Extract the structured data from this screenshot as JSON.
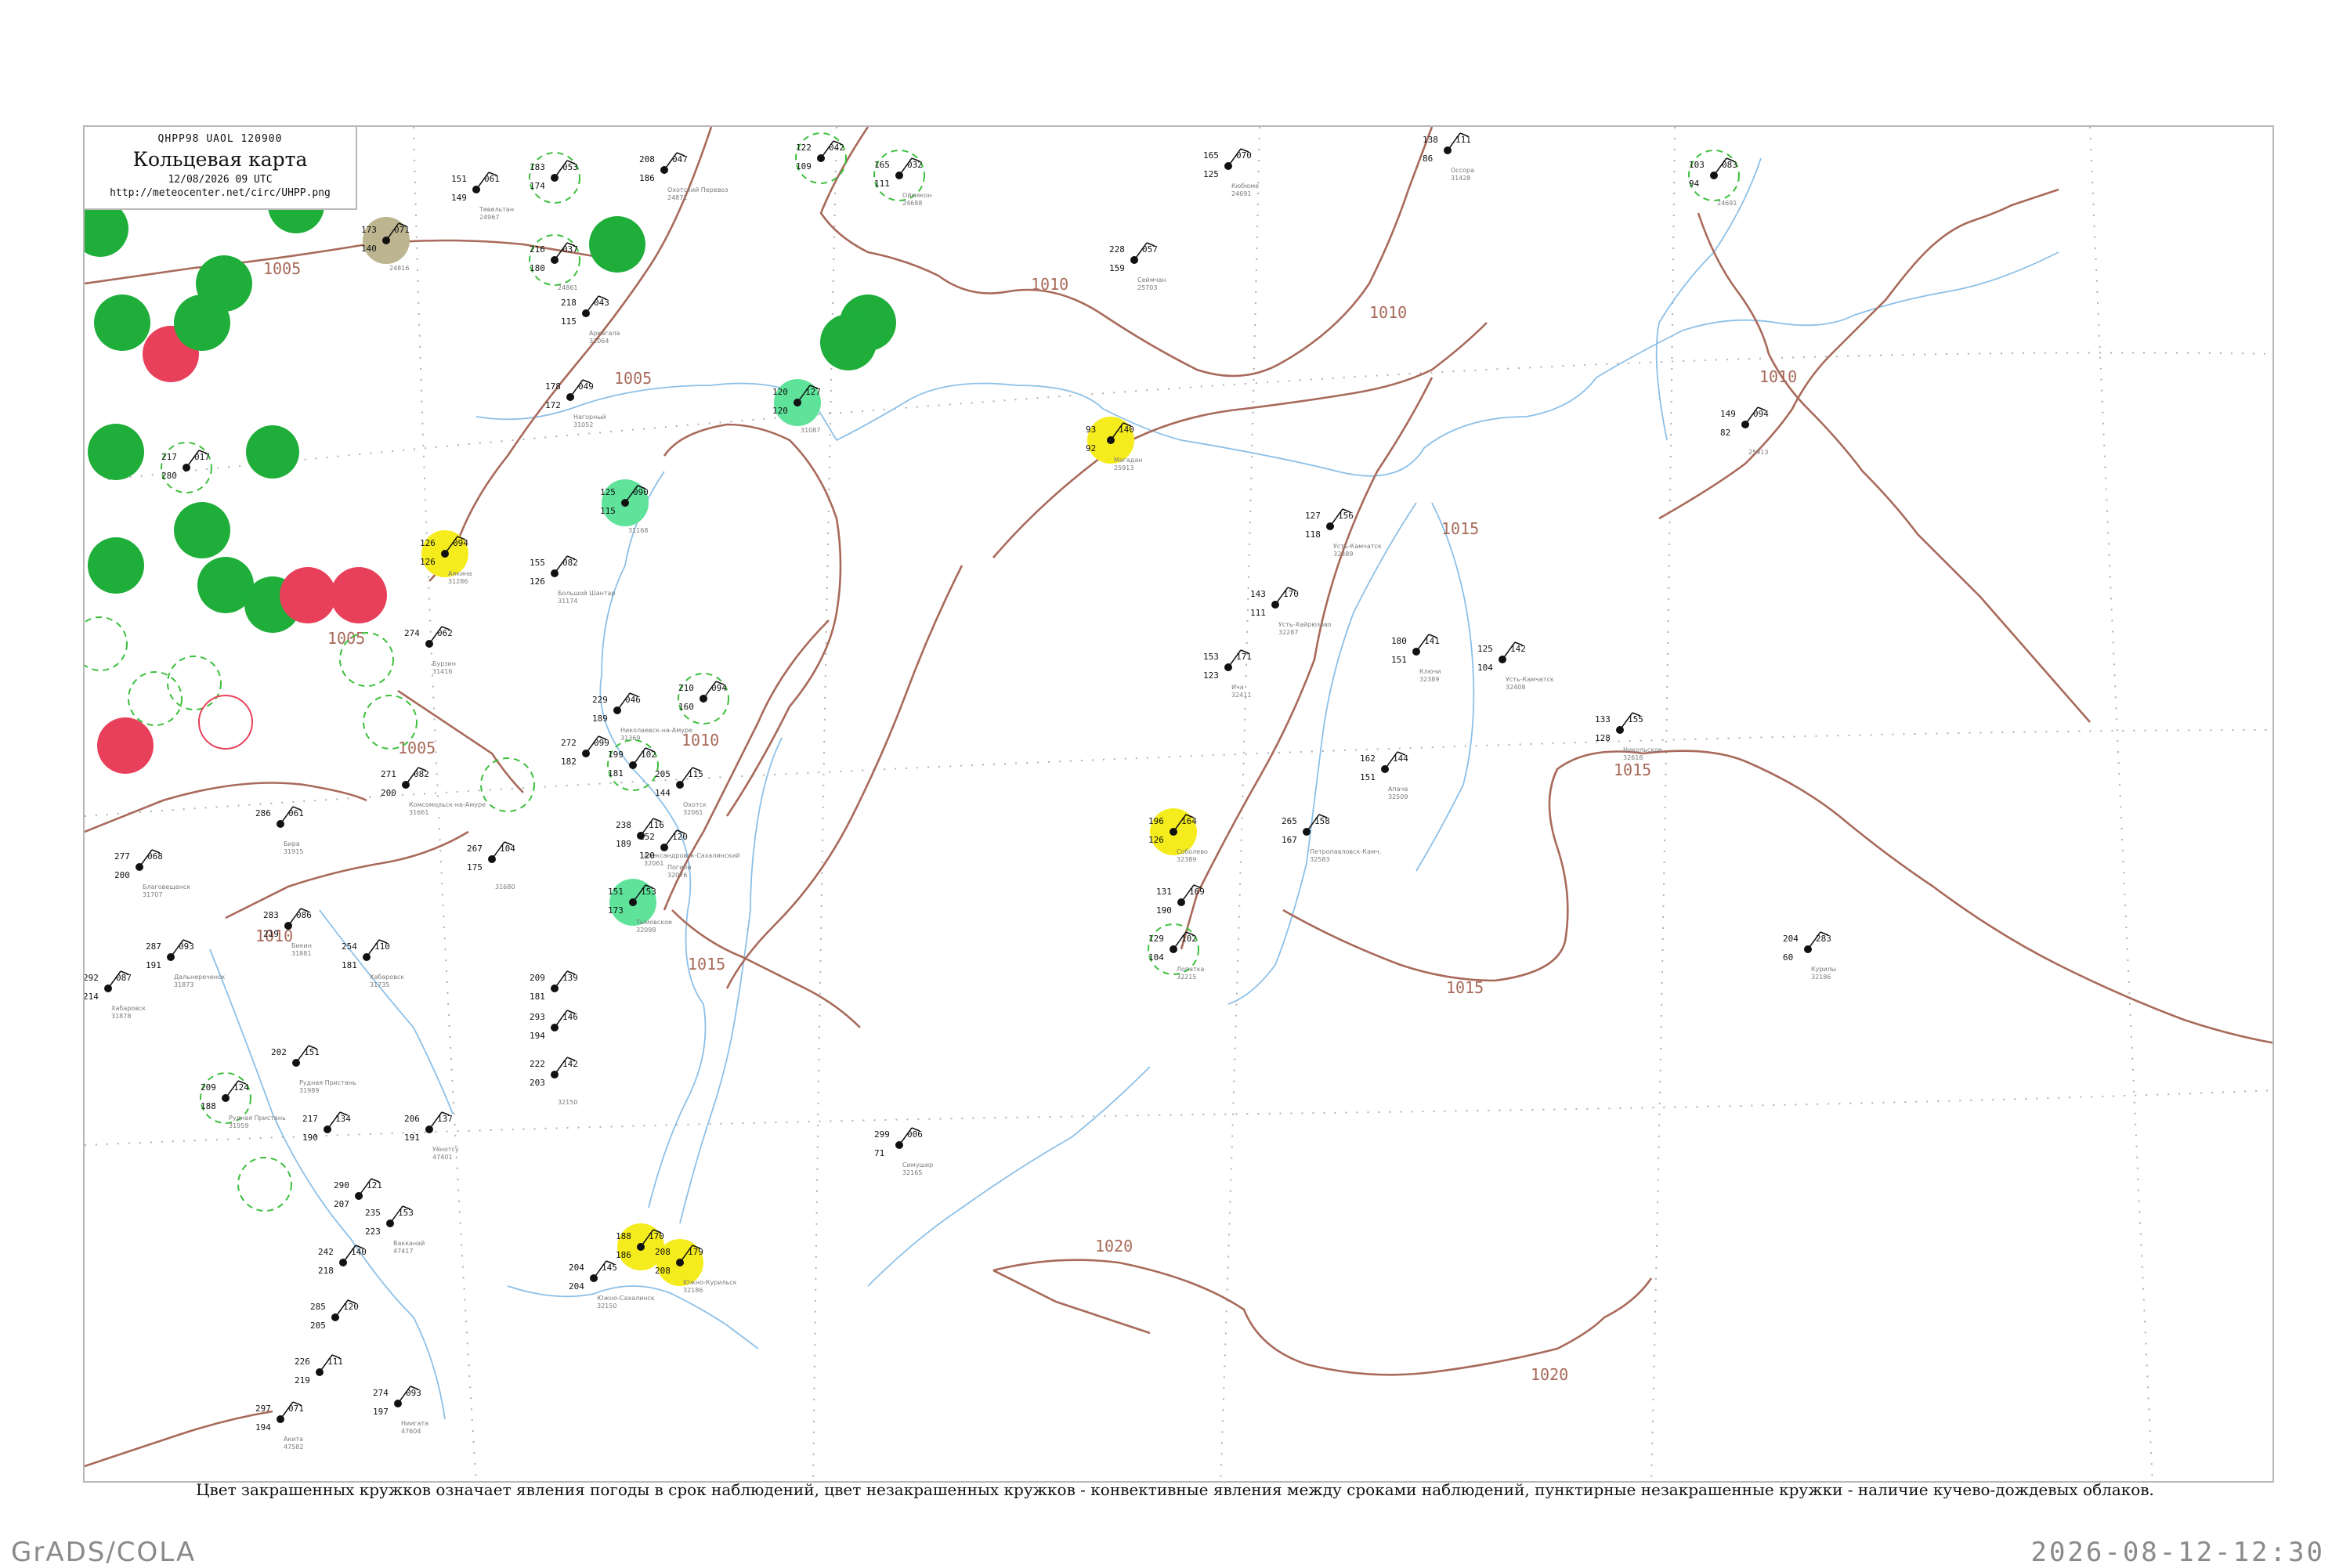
{
  "header": {
    "code": "QHPP98  UAOL  120900",
    "title": "Кольцевая карта",
    "datetime": "12/08/2026 09 UTC",
    "url": "http://meteocenter.net/circ/UHPP.png"
  },
  "caption": "Цвет закрашенных кружков означает явления погоды в срок наблюдений, цвет незакрашенных кружков - конвективные явления между сроками наблюдений, пунктирные незакрашенные кружки - наличие кучево-дождевых облаков.",
  "footer": {
    "left": "GrADS/COLA",
    "right": "2026-08-12-12:30"
  },
  "colors": {
    "isobar": "#a86a5a",
    "coast": "#8cc0e8",
    "rain": "#1fae3a",
    "thunder": "#e8405a",
    "fog": "#f5ec1e",
    "shower": "#5fe39a",
    "haze": "#bdb58f",
    "cb_ring": "#3cbf3c"
  },
  "isobar_labels": [
    "1005",
    "1005",
    "1005",
    "1005",
    "1010",
    "1010",
    "1010",
    "1010",
    "1010",
    "1015",
    "1015",
    "1015",
    "1015",
    "1020",
    "1020"
  ],
  "stations": [
    {
      "t": "061",
      "p": "151",
      "d": "149",
      "n": "Тевельтан",
      "id": "24967"
    },
    {
      "t": "053",
      "p": "183",
      "d": "174",
      "n": "",
      "id": "",
      "c": "cb"
    },
    {
      "t": "047",
      "p": "208",
      "d": "186",
      "n": "Охотский Перевоз",
      "id": "24871"
    },
    {
      "t": "042",
      "p": "122",
      "d": "109",
      "n": "",
      "id": "",
      "c": "cb"
    },
    {
      "t": "032",
      "p": "165",
      "d": "111",
      "n": "Оймякон",
      "id": "24688",
      "c": "cb"
    },
    {
      "t": "070",
      "p": "165",
      "d": "125",
      "n": "Кюбюме",
      "id": "24691"
    },
    {
      "t": "111",
      "p": "138",
      "d": "86",
      "n": "Оссора",
      "id": "31428"
    },
    {
      "t": "083",
      "p": "103",
      "d": "94",
      "n": "",
      "id": "24691",
      "c": "cb"
    },
    {
      "t": "071",
      "p": "173",
      "d": "140",
      "n": "",
      "id": "24816",
      "c": "haze"
    },
    {
      "t": "037",
      "p": "216",
      "d": "180",
      "n": "",
      "id": "24861",
      "c": "cb"
    },
    {
      "t": "043",
      "p": "218",
      "d": "115",
      "n": "Аркагала",
      "id": "31064"
    },
    {
      "t": "057",
      "p": "228",
      "d": "159",
      "n": "Сеймчан",
      "id": "25703"
    },
    {
      "t": "049",
      "p": "178",
      "d": "172",
      "n": "Нагорный",
      "id": "31052"
    },
    {
      "t": "127",
      "p": "120",
      "d": "120",
      "n": "",
      "id": "31087",
      "c": "shower"
    },
    {
      "t": "140",
      "p": "93",
      "d": "92",
      "n": "Магадан",
      "id": "25913",
      "c": "fog"
    },
    {
      "t": "094",
      "p": "149",
      "d": "82",
      "n": "",
      "id": "25913"
    },
    {
      "t": "017",
      "p": "217",
      "d": "280",
      "n": "",
      "id": "",
      "c": "cb"
    },
    {
      "t": "090",
      "p": "125",
      "d": "115",
      "n": "",
      "id": "31168",
      "c": "shower"
    },
    {
      "t": "094",
      "p": "126",
      "d": "126",
      "n": "Аякина",
      "id": "31286",
      "c": "fog"
    },
    {
      "t": "082",
      "p": "155",
      "d": "126",
      "n": "Большой Шантар",
      "id": "31174"
    },
    {
      "t": "156",
      "p": "127",
      "d": "118",
      "n": "Усть-Камчатск",
      "id": "32389"
    },
    {
      "t": "170",
      "p": "143",
      "d": "111",
      "n": "Усть-Хайрюзово",
      "id": "32287"
    },
    {
      "t": "062",
      "p": "274",
      "d": "",
      "n": "Бурзин",
      "id": "31416"
    },
    {
      "t": "141",
      "p": "180",
      "d": "151",
      "n": "Ключи",
      "id": "32389"
    },
    {
      "t": "142",
      "p": "125",
      "d": "104",
      "n": "Усть-Камчатск",
      "id": "32408"
    },
    {
      "t": "171",
      "p": "153",
      "d": "123",
      "n": "Ича",
      "id": "32411"
    },
    {
      "t": "094",
      "p": "210",
      "d": "160",
      "n": "",
      "id": "",
      "c": "cb"
    },
    {
      "t": "046",
      "p": "229",
      "d": "189",
      "n": "Николаевск-на-Амуре",
      "id": "31369"
    },
    {
      "t": "155",
      "p": "133",
      "d": "128",
      "n": "Никольское",
      "id": "32618"
    },
    {
      "t": "099",
      "p": "272",
      "d": "182",
      "n": "",
      "id": ""
    },
    {
      "t": "102",
      "p": "199",
      "d": "181",
      "n": "",
      "id": "",
      "c": "cb"
    },
    {
      "t": "115",
      "p": "205",
      "d": "144",
      "n": "Охотск",
      "id": "32061"
    },
    {
      "t": "144",
      "p": "162",
      "d": "151",
      "n": "Апача",
      "id": "32509"
    },
    {
      "t": "164",
      "p": "196",
      "d": "126",
      "n": "Соболево",
      "id": "32389",
      "c": "fog"
    },
    {
      "t": "158",
      "p": "265",
      "d": "167",
      "n": "Петропавловск-Камч.",
      "id": "32583"
    },
    {
      "t": "116",
      "p": "238",
      "d": "189",
      "n": "Александровск-Сахалинский",
      "id": "32061"
    },
    {
      "t": "120",
      "p": "152",
      "d": "120",
      "n": "Погиби",
      "id": "32076"
    },
    {
      "t": "082",
      "p": "271",
      "d": "200",
      "n": "Комсомольск-на-Амуре",
      "id": "31661"
    },
    {
      "t": "104",
      "p": "267",
      "d": "175",
      "n": "",
      "id": "31680"
    },
    {
      "t": "153",
      "p": "151",
      "d": "173",
      "n": "Тымовское",
      "id": "32098",
      "c": "shower"
    },
    {
      "t": "169",
      "p": "131",
      "d": "190",
      "n": "",
      "id": ""
    },
    {
      "t": "102",
      "p": "129",
      "d": "104",
      "n": "Лопатка",
      "id": "32215",
      "c": "cb"
    },
    {
      "t": "283",
      "p": "204",
      "d": "60",
      "n": "Курилы",
      "id": "32186"
    },
    {
      "t": "139",
      "p": "209",
      "d": "181",
      "n": "",
      "id": ""
    },
    {
      "t": "146",
      "p": "293",
      "d": "194",
      "n": "",
      "id": ""
    },
    {
      "t": "142",
      "p": "222",
      "d": "203",
      "n": "",
      "id": "32150"
    },
    {
      "t": "006",
      "p": "299",
      "d": "71",
      "n": "Симушир",
      "id": "32165"
    },
    {
      "t": "170",
      "p": "188",
      "d": "186",
      "n": "",
      "id": "",
      "c": "fog"
    },
    {
      "t": "179",
      "p": "208",
      "d": "208",
      "n": "Южно-Курильск",
      "id": "32186",
      "c": "fog"
    },
    {
      "t": "145",
      "p": "204",
      "d": "204",
      "n": "Южно-Сахалинск",
      "id": "32150"
    },
    {
      "t": "110",
      "p": "254",
      "d": "181",
      "n": "Хабаровск",
      "id": "31735"
    },
    {
      "t": "086",
      "p": "283",
      "d": "219",
      "n": "Бикин",
      "id": "31881"
    },
    {
      "t": "093",
      "p": "287",
      "d": "191",
      "n": "Дальнереченск",
      "id": "31873"
    },
    {
      "t": "061",
      "p": "286",
      "d": "",
      "n": "Бира",
      "id": "31915"
    },
    {
      "t": "068",
      "p": "277",
      "d": "200",
      "n": "Благовещенск",
      "id": "31707"
    },
    {
      "t": "087",
      "p": "292",
      "d": "214",
      "n": "Хабаровск",
      "id": "31878"
    },
    {
      "t": "151",
      "p": "202",
      "d": "",
      "n": "Рудная Пристань",
      "id": "31989"
    },
    {
      "t": "124",
      "p": "209",
      "d": "188",
      "n": "Рудная Пристань",
      "id": "31959",
      "c": "cb"
    },
    {
      "t": "134",
      "p": "217",
      "d": "190",
      "n": "",
      "id": ""
    },
    {
      "t": "137",
      "p": "206",
      "d": "191",
      "n": "Уёнотсу",
      "id": "47401"
    },
    {
      "t": "121",
      "p": "290",
      "d": "207",
      "n": "",
      "id": ""
    },
    {
      "t": "153",
      "p": "235",
      "d": "223",
      "n": "Вакканай",
      "id": "47417"
    },
    {
      "t": "140",
      "p": "242",
      "d": "218",
      "n": "",
      "id": ""
    },
    {
      "t": "120",
      "p": "285",
      "d": "205",
      "n": "",
      "id": ""
    },
    {
      "t": "111",
      "p": "226",
      "d": "219",
      "n": "",
      "id": ""
    },
    {
      "t": "093",
      "p": "274",
      "d": "197",
      "n": "Ниигата",
      "id": "47604"
    },
    {
      "t": "071",
      "p": "297",
      "d": "194",
      "n": "Акита",
      "id": "47582"
    }
  ]
}
